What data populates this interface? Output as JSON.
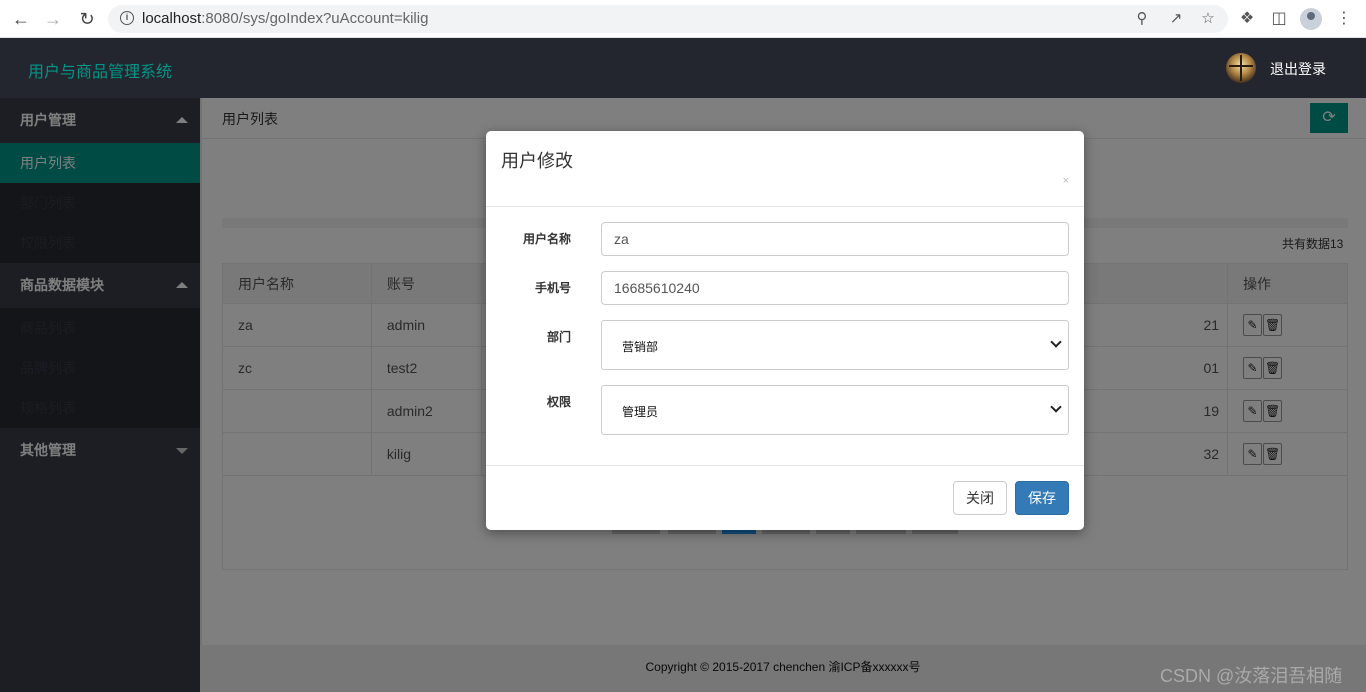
{
  "browser": {
    "url_host": "localhost",
    "url_rest": ":8080/sys/goIndex?uAccount=kilig"
  },
  "header": {
    "app_title": "用户与商品管理系统",
    "logout_label": "退出登录"
  },
  "sidebar": {
    "groups": [
      {
        "label": "用户管理",
        "items": [
          "用户列表",
          "部门列表",
          "权限列表"
        ]
      },
      {
        "label": "商品数据模块",
        "items": [
          "商品列表",
          "品牌列表",
          "规格列表"
        ]
      },
      {
        "label": "其他管理"
      }
    ]
  },
  "main": {
    "tab_title": "用户列表",
    "total_text": "共有数据13",
    "table": {
      "headers": [
        "用户名称",
        "账号",
        "操作"
      ],
      "rows": [
        {
          "name": "za",
          "account": "admin",
          "tail": "21"
        },
        {
          "name": "zc",
          "account": "test2",
          "tail": "01"
        },
        {
          "name": "",
          "account": "admin2",
          "tail": "19"
        },
        {
          "name": "",
          "account": "kilig",
          "tail": "32"
        }
      ]
    }
  },
  "modal": {
    "title": "用户修改",
    "close_x": "×",
    "fields": {
      "username_label": "用户名称",
      "username_value": "za",
      "phone_label": "手机号",
      "phone_value": "16685610240",
      "dept_label": "部门",
      "dept_value": "营销部",
      "perm_label": "权限",
      "perm_value": "管理员"
    },
    "close_button": "关闭",
    "save_button": "保存"
  },
  "footer": {
    "text": "Copyright © 2015-2017 chenchen 渝ICP备xxxxxx号"
  },
  "watermark": "CSDN @汝落泪吾相随",
  "colors": {
    "accent": "#009688",
    "header_bg": "#23262e",
    "sidebar_bg": "#393d49",
    "primary_button": "#337ab7"
  }
}
